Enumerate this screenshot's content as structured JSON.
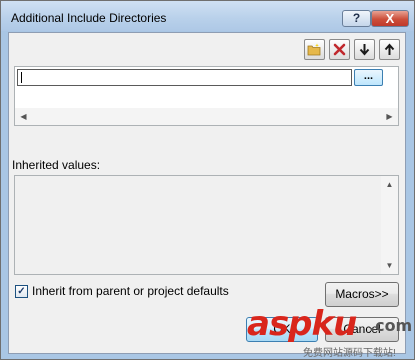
{
  "window": {
    "title": "Additional Include Directories",
    "help_label": "?",
    "close_label": "X"
  },
  "toolbar": {
    "buttons": [
      {
        "icon": "new-folder-icon"
      },
      {
        "icon": "delete-icon"
      },
      {
        "icon": "move-down-icon"
      },
      {
        "icon": "move-up-icon"
      }
    ]
  },
  "directories": {
    "edit_value": "",
    "browse_label": "..."
  },
  "inherited": {
    "label": "Inherited values:"
  },
  "inherit_checkbox": {
    "label": "Inherit from parent or project defaults",
    "checked": true
  },
  "buttons": {
    "macros_label": "Macros>>",
    "ok_label": "OK",
    "cancel_label": "Cancel"
  },
  "watermark": {
    "brand": "aspku",
    "suffix": ".com",
    "tagline": "免费网站源码下载站!"
  },
  "colors": {
    "title_bar": "#b8d0ea",
    "close_button": "#c0392b",
    "delete_icon": "#c0282d",
    "folder_icon": "#e6b84a",
    "watermark_red": "#d9261c"
  }
}
